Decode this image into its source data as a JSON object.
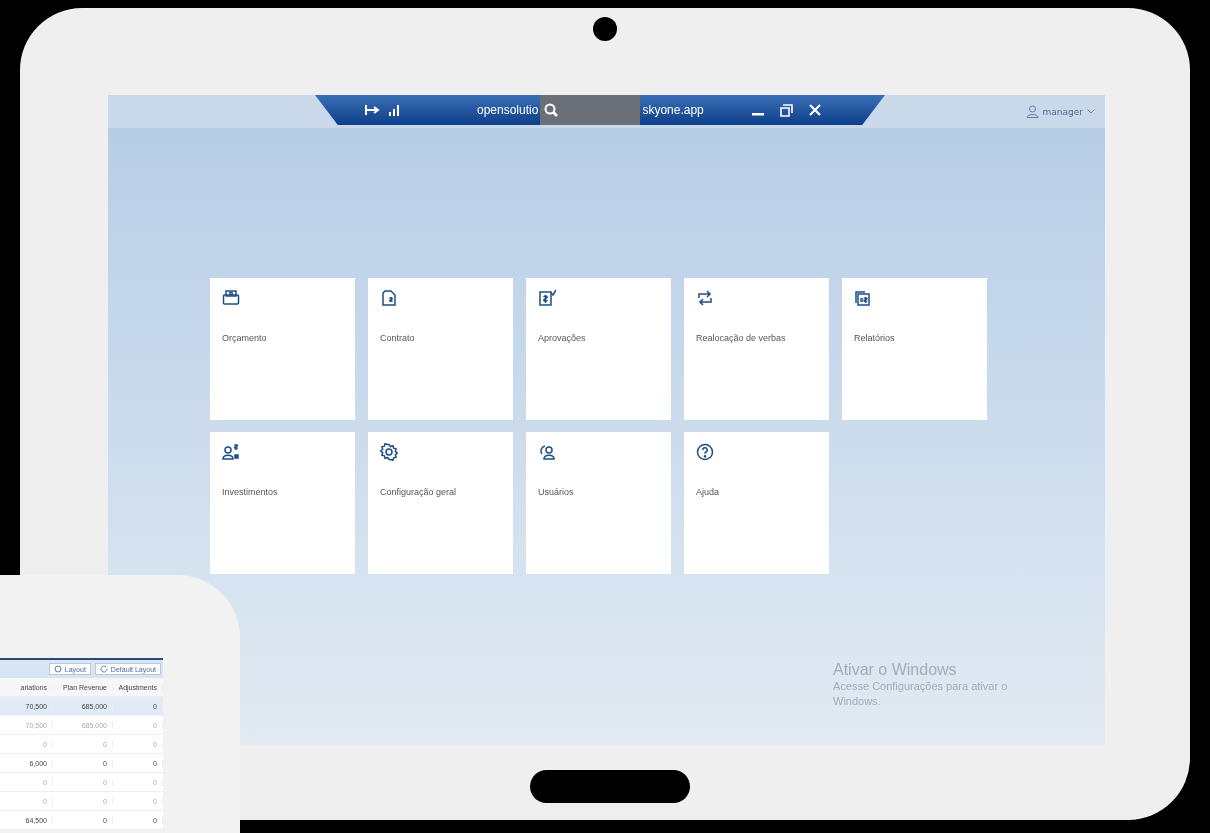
{
  "title_bar": {
    "title_start": "opensolutio",
    "title_end": "skyone.app",
    "user": "manager"
  },
  "tiles": [
    {
      "label": "Orçamento"
    },
    {
      "label": "Contrato"
    },
    {
      "label": "Aprovações"
    },
    {
      "label": "Realocação de verbas"
    },
    {
      "label": "Relatórios"
    },
    {
      "label": "Investimentos"
    },
    {
      "label": "Configuração geral"
    },
    {
      "label": "Usuários"
    },
    {
      "label": "Ajuda"
    }
  ],
  "activation_notice": {
    "title": "Ativar o Windows",
    "text": "Acesse Configurações para ativar o Windows."
  },
  "second_device": {
    "buttons": [
      "Layout",
      "Default Layout"
    ],
    "columns": [
      "ariations",
      "Plan Revenue",
      "Adjustments"
    ],
    "rows": [
      {
        "cells": [
          "70,500",
          "685,000",
          "0"
        ],
        "selected": true,
        "muted": false
      },
      {
        "cells": [
          "70,500",
          "685,000",
          "0"
        ],
        "selected": false,
        "muted": true
      },
      {
        "cells": [
          "0",
          "0",
          "0"
        ],
        "selected": false,
        "muted": true
      },
      {
        "cells": [
          "6,000",
          "0",
          "0"
        ],
        "selected": false,
        "muted": false
      },
      {
        "cells": [
          "0",
          "0",
          "0"
        ],
        "selected": false,
        "muted": true
      },
      {
        "cells": [
          "0",
          "0",
          "0"
        ],
        "selected": false,
        "muted": true
      },
      {
        "cells": [
          "64,500",
          "0",
          "0"
        ],
        "selected": false,
        "muted": false
      }
    ]
  }
}
